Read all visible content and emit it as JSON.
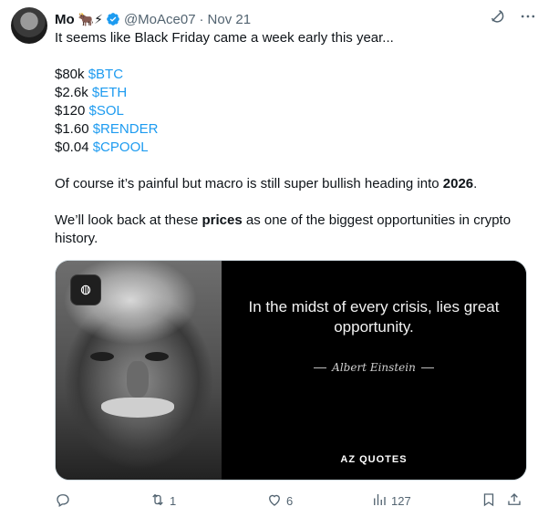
{
  "author": {
    "name": "Mo",
    "emojis": "🐂⚡",
    "handle": "@MoAce07",
    "separator": "·",
    "time": "Nov 21"
  },
  "icons": {
    "verified": "verified-badge-icon",
    "grok": "grok-icon",
    "more": "more-icon",
    "reply": "reply-icon",
    "retweet": "retweet-icon",
    "like": "like-icon",
    "views": "views-icon",
    "bookmark": "bookmark-icon",
    "share": "share-icon"
  },
  "body": {
    "intro": "It seems like Black Friday came a week early this year...",
    "prices": [
      {
        "price": "$80k",
        "ticker": "$BTC"
      },
      {
        "price": "$2.6k",
        "ticker": "$ETH"
      },
      {
        "price": "$120",
        "ticker": "$SOL"
      },
      {
        "price": "$1.60",
        "ticker": "$RENDER"
      },
      {
        "price": "$0.04",
        "ticker": "$CPOOL"
      }
    ],
    "p2_before": "Of course it’s painful but macro is still super bullish heading into ",
    "p2_bold": "2026",
    "p2_after": ".",
    "p3_before": "We’ll look back at these ",
    "p3_bold": "prices",
    "p3_after": " as one of the biggest opportunities in crypto history."
  },
  "media": {
    "quote": "In the midst of every crisis, lies great opportunity.",
    "author": "Albert Einstein",
    "brand": "AZ QUOTES"
  },
  "actions": {
    "reply_count": "",
    "retweet_count": "1",
    "like_count": "6",
    "view_count": "127"
  },
  "colors": {
    "link": "#1d9bf0",
    "verified": "#1d9bf0",
    "muted": "#536471"
  }
}
